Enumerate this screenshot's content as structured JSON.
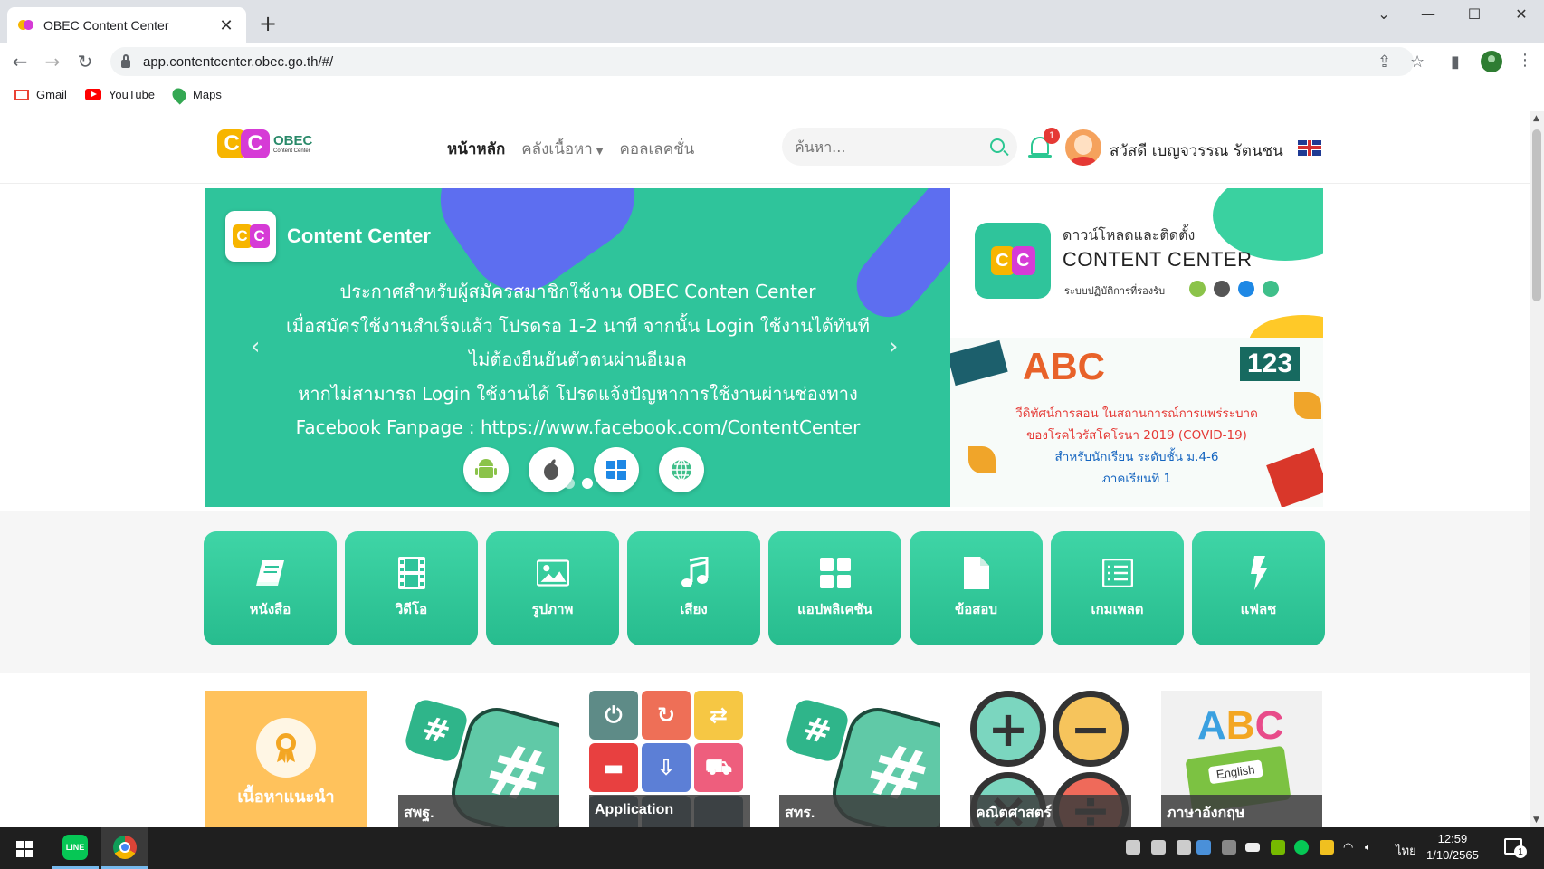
{
  "browser": {
    "tab_title": "OBEC Content Center",
    "tab_close": "✕",
    "new_tab": "+",
    "url": "app.contentcenter.obec.go.th/#/",
    "bookmarks": [
      "Gmail",
      "YouTube",
      "Maps"
    ]
  },
  "site": {
    "logo_title": "OBEC",
    "logo_sub": "Content Center",
    "nav": {
      "home": "หน้าหลัก",
      "library": "คลังเนื้อหา",
      "collection": "คอลเลคชั่น"
    },
    "search_placeholder": "ค้นหา...",
    "notification_count": "1",
    "user_greeting": "สวัสดี เบญจวรรณ รัตนชน"
  },
  "banner": {
    "title": "Content Center",
    "lines": [
      "ประกาศสำหรับผู้สมัครสมาชิกใช้งาน OBEC Conten Center",
      "เมื่อสมัครใช้งานสำเร็จแล้ว โปรดรอ 1-2 นาที จากนั้น Login ใช้งานได้ทันที",
      "ไม่ต้องยืนยันตัวตนผ่านอีเมล",
      "หากไม่สามารถ Login ใช้งานได้ โปรดแจ้งปัญหาการใช้งานผ่านช่องทาง",
      "Facebook Fanpage : https://www.facebook.com/ContentCenter"
    ],
    "prev": "‹",
    "next": "›"
  },
  "side_banner": {
    "download": "ดาวน์โหลดและติดตั้ง",
    "product": "CONTENT CENTER",
    "supported_os": "ระบบปฏิบัติการที่รองรับ",
    "abc": "ABC",
    "num": "123",
    "course_lines": [
      "วีดิทัศน์การสอน ในสถานการณ์การแพร่ระบาด",
      "ของโรคไวรัสโคโรนา 2019 (COVID-19)",
      "สำหรับนักเรียน ระดับชั้น ม.4-6",
      "ภาคเรียนที่ 1"
    ]
  },
  "categories": [
    {
      "label": "หนังสือ",
      "icon": "book-icon"
    },
    {
      "label": "วิดีโอ",
      "icon": "film-icon"
    },
    {
      "label": "รูปภาพ",
      "icon": "image-icon"
    },
    {
      "label": "เสียง",
      "icon": "music-icon"
    },
    {
      "label": "แอปพลิเคชัน",
      "icon": "apps-icon"
    },
    {
      "label": "ข้อสอบ",
      "icon": "document-icon"
    },
    {
      "label": "เกมเพลต",
      "icon": "list-icon"
    },
    {
      "label": "แฟลช",
      "icon": "flash-icon"
    }
  ],
  "tiles": [
    {
      "label": "เนื้อหาแนะนำ"
    },
    {
      "label": "สพฐ."
    },
    {
      "label": "Application"
    },
    {
      "label": "สทร."
    },
    {
      "label": "คณิตศาสตร์"
    },
    {
      "label": "ภาษาอังกฤษ",
      "book_text": "English"
    }
  ],
  "taskbar": {
    "line_label": "LINE",
    "lang": "ไทย",
    "time": "12:59",
    "date": "1/10/2565",
    "notifications": "1"
  },
  "colors": {
    "primary": "#2fc49b",
    "accent": "#5d6ef0",
    "recommend": "#ffc25c"
  }
}
